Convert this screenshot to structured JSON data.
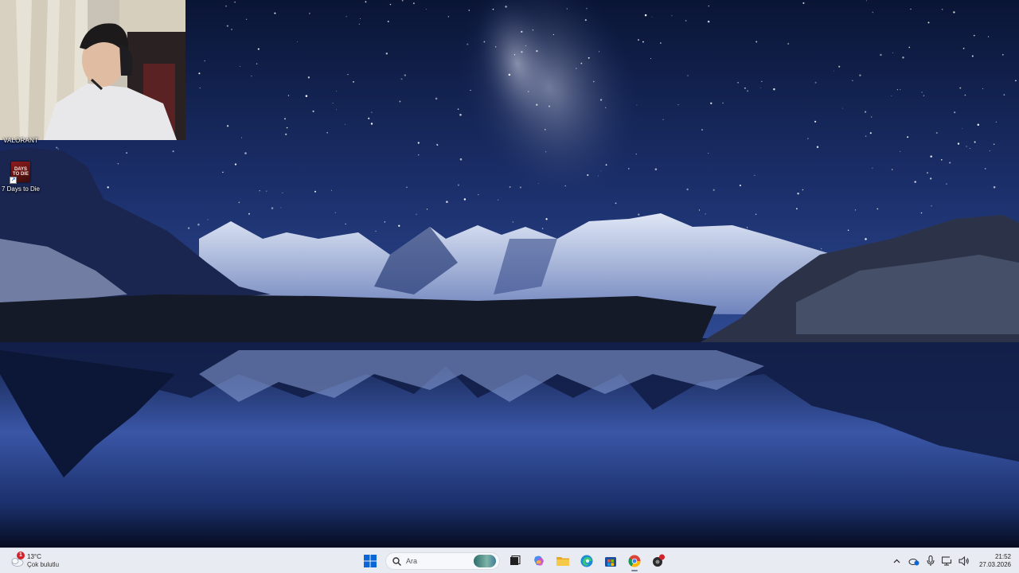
{
  "desktop": {
    "partial_label": "VALORANT",
    "icons": [
      {
        "label": "7 Days to Die",
        "icon_text": "DAYS TO DIE"
      }
    ]
  },
  "taskbar": {
    "weather": {
      "temperature": "13°C",
      "condition": "Çok bulutlu",
      "badge": "1"
    },
    "search": {
      "placeholder": "Ara"
    },
    "pinned": [
      "start-icon",
      "search-icon",
      "task-view-icon",
      "copilot-icon",
      "file-explorer-icon",
      "edge-icon",
      "store-icon",
      "chrome-icon",
      "app-icon"
    ],
    "tray": {
      "time": "21:52",
      "date": "27.03.2026"
    }
  },
  "colors": {
    "sky_top": "#0a1535",
    "sky_mid": "#1c2f6a",
    "taskbar_bg": "#e8ebf2",
    "accent_blue": "#0a66d4",
    "badge_red": "#d4202a"
  }
}
